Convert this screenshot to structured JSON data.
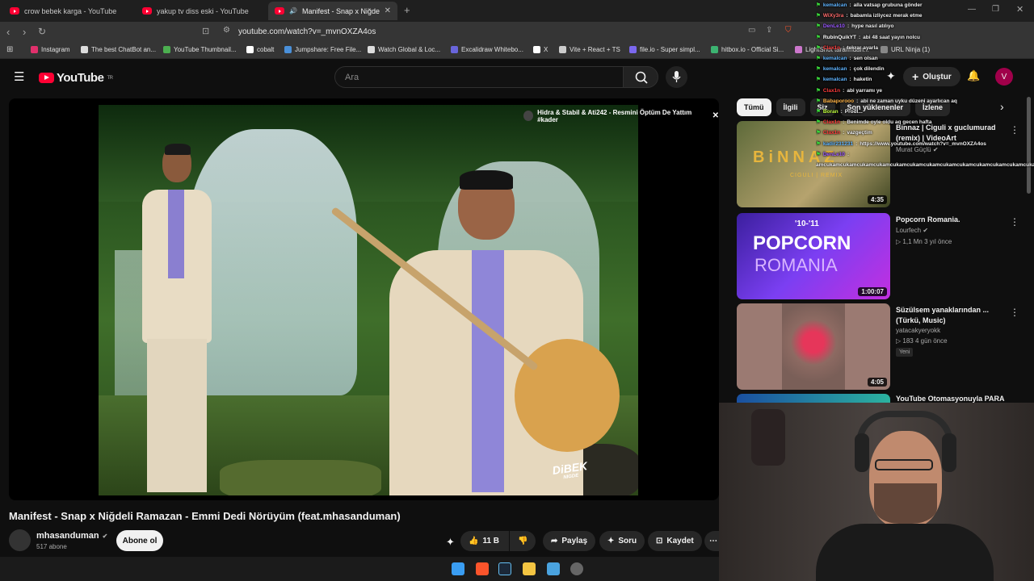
{
  "browser": {
    "tabs": [
      {
        "title": "crow bebek karga - YouTube",
        "active": false
      },
      {
        "title": "yakup tv diss eski - YouTube",
        "active": false
      },
      {
        "title": "Manifest - Snap x Niğdeli Ra",
        "active": true
      }
    ],
    "url": "youtube.com/watch?v=_mvnOXZA4os",
    "bookmarks": [
      {
        "label": "Instagram",
        "color": "#e1306c"
      },
      {
        "label": "The best ChatBot an...",
        "color": "#dddddd"
      },
      {
        "label": "YouTube Thumbnail...",
        "color": "#4caf50"
      },
      {
        "label": "cobalt",
        "color": "#ffffff"
      },
      {
        "label": "Jumpshare: Free File...",
        "color": "#4a90d9"
      },
      {
        "label": "Watch Global & Loc...",
        "color": "#dddddd"
      },
      {
        "label": "Excalidraw Whitebo...",
        "color": "#6965db"
      },
      {
        "label": "X",
        "color": "#ffffff"
      },
      {
        "label": "Vite + React + TS",
        "color": "#cccccc"
      },
      {
        "label": "file.io - Super simpl...",
        "color": "#7b68ee"
      },
      {
        "label": "hitbox.io - Official Si...",
        "color": "#3cb371"
      },
      {
        "label": "LightShot tarafından...",
        "color": "#cc77cc"
      },
      {
        "label": "URL Ninja (1)",
        "color": "#888888"
      }
    ]
  },
  "masthead": {
    "logo_text": "YouTube",
    "logo_sup": "TR",
    "search_placeholder": "Ara",
    "create_label": "Oluştur",
    "avatar_letter": "V"
  },
  "player": {
    "overlay_title": "Hidra & Stabil & Ati242 - Resmini Öptüm De Yattım #kader",
    "brand_mark": "DiBEK",
    "brand_sub": "NIGDE"
  },
  "video": {
    "title": "Manifest - Snap x Niğdeli Ramazan - Emmi Dedi Nörüyüm (feat.mhasanduman)",
    "channel": "mhasanduman",
    "subscribers": "517 abone",
    "subscribe_label": "Abone ol",
    "like_count": "11 B",
    "share_label": "Paylaş",
    "ask_label": "Soru",
    "save_label": "Kaydet"
  },
  "chips": [
    "Tümü",
    "İlgili",
    "Siz",
    "Son yüklenenler",
    "İzlene"
  ],
  "recommendations": [
    {
      "title": "Binnaz | Ciguli x guclumurad (remix) | VideoArt",
      "channel": "Murat Güçlü",
      "verified": true,
      "meta": "",
      "duration": "4:35",
      "thumb_text": "BiNNAZ",
      "thumb_sub": "CIGULI | REMIX"
    },
    {
      "title": "Popcorn Romania.",
      "channel": "Lourfech",
      "verified": true,
      "meta": "1,1 Mn  3 yıl önce",
      "duration": "1:00:07",
      "thumb_text": "POPCORN",
      "thumb_sub": "ROMANIA",
      "thumb_top": "'10-'11"
    },
    {
      "title": "Süzülsem yanaklarından ... (Türkü, Music)",
      "channel": "yatacakyeryokk",
      "verified": false,
      "meta": "183  4 gün önce",
      "badge": "Yeni",
      "duration": "4:05"
    },
    {
      "title": "YouTube Otomasyonuyla PARA",
      "channel": "",
      "verified": false,
      "meta": "",
      "duration": ""
    }
  ],
  "chat": [
    {
      "user": "kemalcan",
      "color": "#5fb4ff",
      "text": "alla vatsap grubuna gönder"
    },
    {
      "user": "WiXy3ra",
      "color": "#ff6b6b",
      "text": "babamla izliycez merak etme"
    },
    {
      "user": "DenLe10",
      "color": "#9b59ff",
      "text": "hype nasıl atılıyo"
    },
    {
      "user": "RubinQuikYT",
      "color": "#ffffff",
      "text": "abi 48 saat yayın nolcu"
    },
    {
      "user": "Clax1n",
      "color": "#ff3b3b",
      "text": "tekrar ayarla"
    },
    {
      "user": "kemalcan",
      "color": "#5fb4ff",
      "text": "sen olsan"
    },
    {
      "user": "kemalcan",
      "color": "#5fb4ff",
      "text": "çok dilendin"
    },
    {
      "user": "kemalcan",
      "color": "#5fb4ff",
      "text": "haketin"
    },
    {
      "user": "Clax1n",
      "color": "#ff3b3b",
      "text": "abi yarramı ye"
    },
    {
      "user": "Babaporooo",
      "color": "#ffb347",
      "text": "abi ne zaman uyku düzeni ayarlıcan aq"
    },
    {
      "user": "Boran",
      "color": "#c0ff3e",
      "text": "Prodl..."
    },
    {
      "user": "Clax1n",
      "color": "#ff3b3b",
      "text": "Benimde oyle oldu aq gecen hafta"
    },
    {
      "user": "Clax1n",
      "color": "#ff3b3b",
      "text": "vazgeçtim"
    },
    {
      "user": "kadir231231",
      "color": "#5fb4ff",
      "text": "https://www.youtube.com/watch?v=_mvnOXZA4os"
    },
    {
      "user": "DenLe10",
      "color": "#9b59ff",
      "text": ""
    },
    {
      "user": "",
      "color": "#ffffff",
      "text": "amcukamcukamcukamcukamcukamcukamcukamcukamcukamcukamcukamcukamcukamcuk"
    }
  ],
  "taskbar_icons": [
    {
      "name": "windows-start-icon",
      "color": "#3a9df2"
    },
    {
      "name": "brave-browser-icon",
      "color": "#fb542b"
    },
    {
      "name": "steam-icon",
      "color": "#1b2838"
    },
    {
      "name": "file-explorer-icon",
      "color": "#f4c542"
    },
    {
      "name": "photos-icon",
      "color": "#4aa3df"
    },
    {
      "name": "obs-icon",
      "color": "#666666"
    }
  ]
}
